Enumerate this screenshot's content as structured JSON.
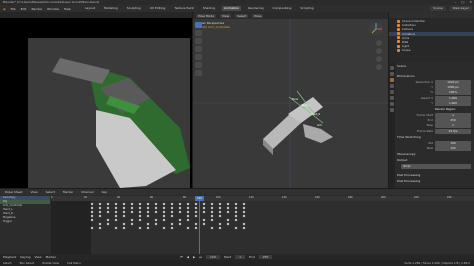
{
  "title": "Blender* [C:\\Users\\Pleesiel\\Documents\\Super Scout\\Main.blend]",
  "window_controls": [
    "–",
    "□",
    "✕"
  ],
  "menu": [
    "File",
    "Edit",
    "Render",
    "Window",
    "Help"
  ],
  "workspaces": [
    "Layout",
    "Modeling",
    "Sculpting",
    "UV Editing",
    "Texture Paint",
    "Shading",
    "Animation",
    "Rendering",
    "Compositing",
    "Scripting"
  ],
  "active_workspace": "Animation",
  "scene": {
    "name": "Scene",
    "view_layer": "View Layer"
  },
  "viewport": {
    "mode": "Pose Mode",
    "menus": [
      "View",
      "Select",
      "Pose"
    ],
    "info_line1": "User Perspective",
    "info_line2": "(120) Arm_Controller",
    "bone_labels": [
      "Bone",
      "Hand_L",
      "Hand_R",
      "Arm"
    ]
  },
  "outliner": {
    "rows": [
      {
        "label": "Scene Collection",
        "selected": false
      },
      {
        "label": "Collection",
        "selected": false
      },
      {
        "label": "Camera",
        "selected": false
      },
      {
        "label": "Armature",
        "selected": true
      },
      {
        "label": "Arms",
        "selected": false
      },
      {
        "label": "Rifle",
        "selected": false
      },
      {
        "label": "Light",
        "selected": false
      },
      {
        "label": "Scope",
        "selected": false
      }
    ]
  },
  "properties": {
    "object_name": "Scene",
    "sections": {
      "dimensions": "Dimensions",
      "resolution_x_label": "Resolution X",
      "resolution_x": "1920 px",
      "resolution_y_label": "Y",
      "resolution_y": "1080 px",
      "percent_label": "%",
      "percent": "100%",
      "aspect_x_label": "Aspect X",
      "aspect_x": "1.000",
      "aspect_y_label": "Y",
      "aspect_y": "1.000",
      "render_region": "Render Region",
      "frame_start_label": "Frame Start",
      "frame_start": "1",
      "frame_end_label": "End",
      "frame_end": "250",
      "step_label": "Step",
      "step": "1",
      "frame_rate_label": "Frame Rate",
      "frame_rate": "24 fps",
      "time_stretching": "Time Stretching",
      "old_label": "Old",
      "old": "100",
      "new_label": "New",
      "new": "100",
      "stereoscopy": "Stereoscopy",
      "output": "Output",
      "output_path": "/tmp\\",
      "post_processing": "Post Processing",
      "postprocessing2": "Post Processing"
    }
  },
  "dopesheet": {
    "mode": "Dope Sheet",
    "menus": [
      "View",
      "Select",
      "Marker",
      "Channel",
      "Key"
    ],
    "summary_label": "Summary",
    "channels": [
      "Summary",
      "Rig",
      "Arm_Controller",
      "Hand_L",
      "Hand_R",
      "Magazine",
      "Trigger"
    ],
    "playhead": "120",
    "frames": [
      "0",
      "20",
      "40",
      "60",
      "80",
      "100",
      "120",
      "140",
      "160",
      "180",
      "200",
      "220",
      "240"
    ]
  },
  "timeline": {
    "items": [
      "Playback",
      "Keying",
      "View",
      "Marker"
    ],
    "current_frame": "120",
    "start_label": "Start",
    "start": "1",
    "end_label": "End",
    "end": "250"
  },
  "status": {
    "left": [
      "Select",
      "Box Select",
      "Rotate View",
      "Call Menu"
    ],
    "right": "Verts 1,284 | Faces 1,206 | Objects 1/6 | 2.83.0"
  },
  "colors": {
    "accent": "#4772b3",
    "gun_green": "#2f6b2f",
    "bone_gray": "#bdbdbd"
  }
}
